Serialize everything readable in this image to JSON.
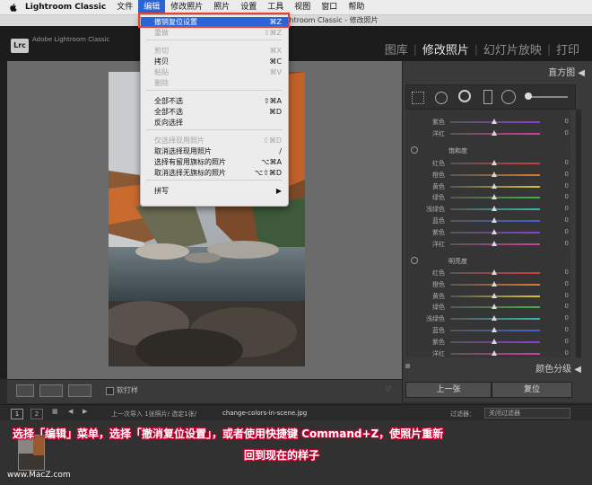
{
  "menubar": {
    "app": "Lightroom Classic",
    "items": [
      "文件",
      "编辑",
      "修改照片",
      "照片",
      "设置",
      "工具",
      "视图",
      "窗口",
      "帮助"
    ]
  },
  "window_title": "Adobe Photoshop Lightroom Classic - 修改照片",
  "header": {
    "logo": "Lrc",
    "app_name": "Adobe Lightroom Classic",
    "modules": [
      "图库",
      "修改照片",
      "幻灯片放映",
      "打印"
    ]
  },
  "edit_menu": {
    "items": [
      {
        "label": "撤销复位设置",
        "shortcut": "⌘Z",
        "state": "highlighted"
      },
      {
        "label": "重做",
        "shortcut": "⇧⌘Z",
        "state": "disabled"
      },
      {
        "label": "剪切",
        "shortcut": "⌘X",
        "state": "disabled"
      },
      {
        "label": "拷贝",
        "shortcut": "⌘C",
        "state": "enabled"
      },
      {
        "label": "粘贴",
        "shortcut": "⌘V",
        "state": "disabled"
      },
      {
        "label": "删除",
        "shortcut": "",
        "state": "disabled"
      },
      {
        "label": "全部不选",
        "shortcut": "⇧⌘A",
        "state": "enabled"
      },
      {
        "label": "全部不选",
        "shortcut": "⌘D",
        "state": "enabled"
      },
      {
        "label": "反向选择",
        "shortcut": "",
        "state": "enabled"
      },
      {
        "label": "仅选择现用照片",
        "shortcut": "⇧⌘D",
        "state": "disabled"
      },
      {
        "label": "取消选择现用照片",
        "shortcut": "/",
        "state": "enabled"
      },
      {
        "label": "选择有留用旗标的照片",
        "shortcut": "⌥⌘A",
        "state": "enabled"
      },
      {
        "label": "取消选择无旗标的照片",
        "shortcut": "⌥⇧⌘D",
        "state": "enabled"
      },
      {
        "label": "拼写",
        "shortcut": "▶",
        "state": "enabled"
      }
    ]
  },
  "right_panel": {
    "histogram_title": "直方图 ◀",
    "partial_rows": [
      {
        "label": "紫色",
        "value": "0",
        "color": "#8a3fd0"
      },
      {
        "label": "洋红",
        "value": "0",
        "color": "#d03f9a"
      }
    ],
    "saturation": {
      "title": "饱和度",
      "rows": [
        {
          "label": "红色",
          "value": "0",
          "color": "#d23b3b"
        },
        {
          "label": "橙色",
          "value": "0",
          "color": "#d97c2a"
        },
        {
          "label": "黄色",
          "value": "0",
          "color": "#d8c334"
        },
        {
          "label": "绿色",
          "value": "0",
          "color": "#47b04a"
        },
        {
          "label": "浅绿色",
          "value": "0",
          "color": "#36b7b0"
        },
        {
          "label": "蓝色",
          "value": "0",
          "color": "#3b63d2"
        },
        {
          "label": "紫色",
          "value": "0",
          "color": "#8a3fd0"
        },
        {
          "label": "洋红",
          "value": "0",
          "color": "#d03f9a"
        }
      ]
    },
    "luminance": {
      "title": "明亮度",
      "rows": [
        {
          "label": "红色",
          "value": "0",
          "color": "#d23b3b"
        },
        {
          "label": "橙色",
          "value": "0",
          "color": "#d97c2a"
        },
        {
          "label": "黄色",
          "value": "0",
          "color": "#d8c334"
        },
        {
          "label": "绿色",
          "value": "0",
          "color": "#47b04a"
        },
        {
          "label": "浅绿色",
          "value": "0",
          "color": "#36b7b0"
        },
        {
          "label": "蓝色",
          "value": "0",
          "color": "#3b63d2"
        },
        {
          "label": "紫色",
          "value": "0",
          "color": "#8a3fd0"
        },
        {
          "label": "洋红",
          "value": "0",
          "color": "#d03f9a"
        }
      ]
    },
    "color_grading": "颜色分级 ◀",
    "prev_button": "上一张",
    "reset_button": "复位"
  },
  "toolbar": {
    "soft_proof": "软打样"
  },
  "filmstrip_bar": {
    "page1": "1",
    "page2": "2",
    "info": "上一次导入  1张照片/ 选定1张/",
    "filename": "change-colors-in-scene.jpg",
    "filter_label": "过滤器：",
    "filter_value": "关闭过滤器"
  },
  "caption": {
    "line1": "选择「编辑」菜单，选择「撤消复位设置」，或者使用快捷键 Command+Z，使照片重新",
    "line2": "回到现在的样子"
  },
  "watermark": "www.MacZ.com",
  "colors": {
    "menu_highlight": "#2a64d6",
    "callout_border": "#e8412e",
    "caption_outline": "#cc0033"
  }
}
